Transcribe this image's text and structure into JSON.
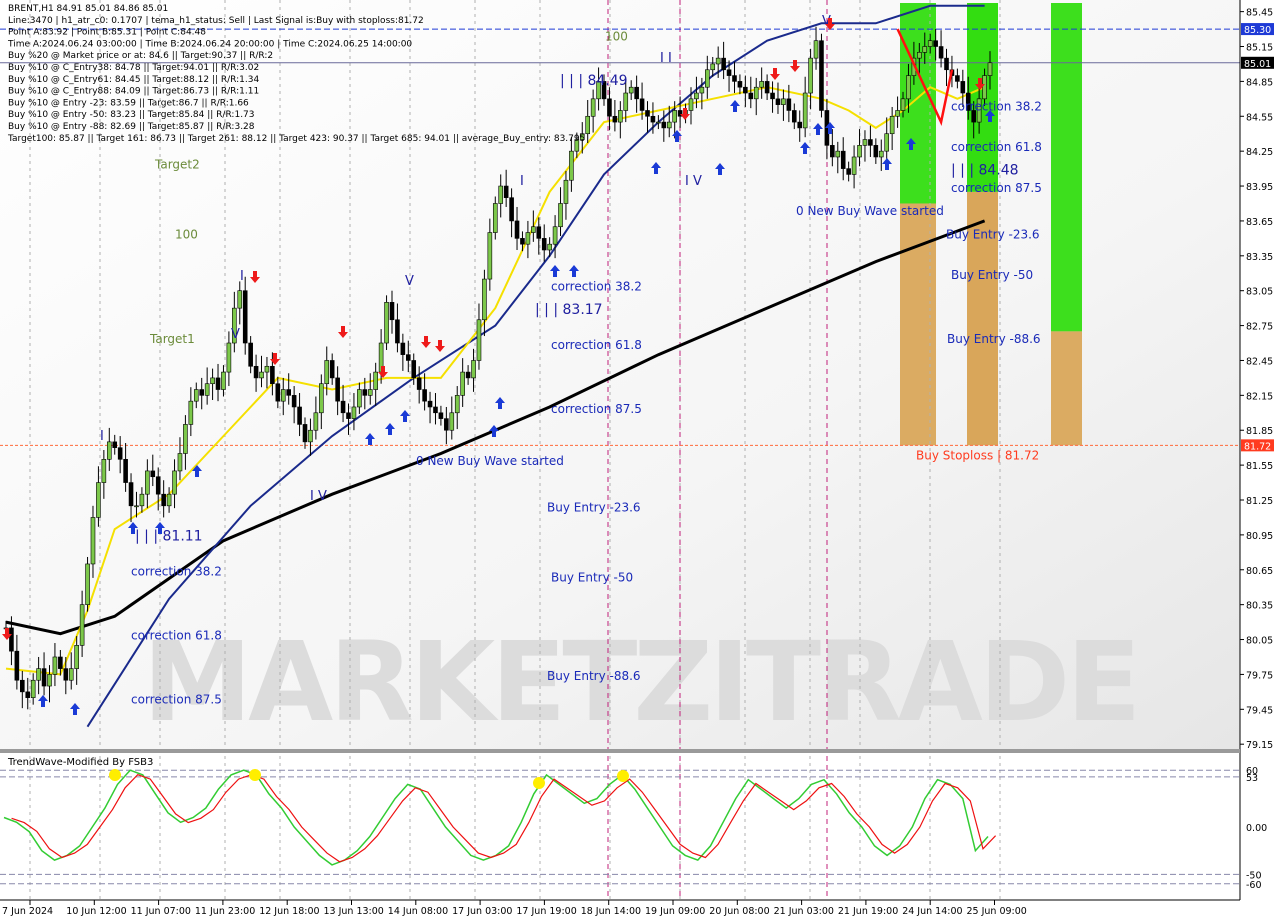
{
  "header": {
    "lines": [
      "BRENT,H1  84.91 85.01 84.86 85.01",
      "Line:3470  |  h1_atr_c0: 0.1707  |  tema_h1_status: Sell  |  Last Signal is:Buy with stoploss:81.72",
      "Point A:83.92  |  Point B:85.31  |  Point C:84.48",
      "Time A:2024.06.24 03:00:00  |  Time B:2024.06.24 20:00:00  |  Time C:2024.06.25 14:00:00",
      "Buy %20 @ Market price or at: 84.6  ||  Target:90.37  ||  R/R:2",
      "Buy %10 @ C_Entry38: 84.78  ||  Target:94.01  ||  R/R:3.02",
      "Buy %10 @ C_Entry61: 84.45  ||  Target:88.12  ||  R/R:1.34",
      "Buy %10 @ C_Entry88: 84.09  ||  Target:86.73  ||  R/R:1.11",
      "Buy %10 @ Entry -23: 83.59  ||  Target:86.7  ||  R/R:1.66",
      "Buy %10 @ Entry -50: 83.23  ||  Target:85.84  ||  R/R:1.73",
      "Buy %10 @ Entry -88: 82.69  ||  Target:85.87  ||  R/R:3.28",
      "Target100: 85.87  ||  Target 161: 86.73  ||  Target 261: 88.12  ||  Target 423: 90.37  ||  Target 685: 94.01  ||  average_Buy_entry: 83.795"
    ]
  },
  "watermark": "MARKETZITRADE",
  "chart_data": {
    "type": "line",
    "symbol": "BRENT,H1",
    "y_ticks": [
      "85.45",
      "85.15",
      "84.85",
      "84.55",
      "84.25",
      "83.95",
      "83.65",
      "83.35",
      "83.05",
      "82.75",
      "82.45",
      "82.15",
      "81.85",
      "81.55",
      "81.25",
      "80.95",
      "80.65",
      "80.35",
      "80.05",
      "79.75",
      "79.45",
      "79.15"
    ],
    "ylim": [
      79.1,
      85.55
    ],
    "x_ticks": [
      "7 Jun 2024",
      "10 Jun 12:00",
      "11 Jun 07:00",
      "11 Jun 23:00",
      "12 Jun 18:00",
      "13 Jun 13:00",
      "14 Jun 08:00",
      "17 Jun 03:00",
      "17 Jun 19:00",
      "18 Jun 14:00",
      "19 Jun 09:00",
      "20 Jun 08:00",
      "21 Jun 03:00",
      "21 Jun 19:00",
      "24 Jun 14:00",
      "25 Jun 09:00"
    ],
    "price_tags": [
      {
        "label": "85.30",
        "value": 85.3,
        "color": "#1e3ad6"
      },
      {
        "label": "85.01",
        "value": 85.01,
        "color": "#000000"
      },
      {
        "label": "81.72",
        "value": 81.72,
        "color": "#ff3b1f"
      }
    ],
    "close_series": [
      80.15,
      79.95,
      79.7,
      79.6,
      79.55,
      79.7,
      79.8,
      79.65,
      79.75,
      79.9,
      79.8,
      79.7,
      79.8,
      80.0,
      80.35,
      80.7,
      81.1,
      81.4,
      81.6,
      81.75,
      81.7,
      81.6,
      81.4,
      81.2,
      81.2,
      81.3,
      81.5,
      81.45,
      81.3,
      81.2,
      81.3,
      81.5,
      81.65,
      81.9,
      82.1,
      82.2,
      82.15,
      82.25,
      82.3,
      82.2,
      82.35,
      82.6,
      82.9,
      83.05,
      82.6,
      82.4,
      82.3,
      82.35,
      82.4,
      82.25,
      82.1,
      82.2,
      82.15,
      82.05,
      81.9,
      81.75,
      81.85,
      82.0,
      82.25,
      82.45,
      82.3,
      82.1,
      82.0,
      81.95,
      82.05,
      82.2,
      82.15,
      82.2,
      82.35,
      82.6,
      82.95,
      82.8,
      82.6,
      82.5,
      82.45,
      82.3,
      82.2,
      82.1,
      82.05,
      82.0,
      81.95,
      81.85,
      82.0,
      82.15,
      82.35,
      82.3,
      82.45,
      82.8,
      83.15,
      83.55,
      83.8,
      83.95,
      83.85,
      83.65,
      83.5,
      83.45,
      83.55,
      83.6,
      83.5,
      83.4,
      83.45,
      83.6,
      83.8,
      84.0,
      84.25,
      84.35,
      84.4,
      84.55,
      84.7,
      84.85,
      84.7,
      84.55,
      84.5,
      84.6,
      84.75,
      84.8,
      84.7,
      84.6,
      84.55,
      84.5,
      84.5,
      84.45,
      84.5,
      84.6,
      84.55,
      84.6,
      84.7,
      84.75,
      84.8,
      84.95,
      85.0,
      85.05,
      84.95,
      84.9,
      84.85,
      84.8,
      84.75,
      84.7,
      84.8,
      84.85,
      84.75,
      84.7,
      84.65,
      84.7,
      84.6,
      84.5,
      84.45,
      84.75,
      85.05,
      85.2,
      84.6,
      84.3,
      84.2,
      84.25,
      84.1,
      84.05,
      84.2,
      84.3,
      84.35,
      84.3,
      84.2,
      84.25,
      84.4,
      84.55,
      84.6,
      84.7,
      84.9,
      85.05,
      85.1,
      85.15,
      85.2,
      85.15,
      85.05,
      84.95,
      84.9,
      84.85,
      84.75,
      84.6,
      84.5,
      84.7,
      84.9,
      85.01
    ],
    "indicator_lines": [
      {
        "name": "long-ma",
        "color": "#000000",
        "points": [
          [
            0,
            80.2
          ],
          [
            10,
            80.1
          ],
          [
            20,
            80.25
          ],
          [
            40,
            80.9
          ],
          [
            60,
            81.3
          ],
          [
            80,
            81.65
          ],
          [
            100,
            82.05
          ],
          [
            120,
            82.5
          ],
          [
            140,
            82.9
          ],
          [
            160,
            83.3
          ],
          [
            180,
            83.65
          ]
        ]
      },
      {
        "name": "fast-ma",
        "color": "#1a2a8c",
        "points": [
          [
            15,
            79.3
          ],
          [
            30,
            80.4
          ],
          [
            45,
            81.2
          ],
          [
            60,
            81.8
          ],
          [
            75,
            82.3
          ],
          [
            90,
            82.75
          ],
          [
            100,
            83.35
          ],
          [
            110,
            84.05
          ],
          [
            120,
            84.5
          ],
          [
            130,
            84.9
          ],
          [
            140,
            85.2
          ],
          [
            150,
            85.35
          ],
          [
            160,
            85.35
          ],
          [
            170,
            85.5
          ],
          [
            180,
            85.5
          ]
        ]
      },
      {
        "name": "yellow-line",
        "color": "#f5e000",
        "points": [
          [
            0,
            79.8
          ],
          [
            10,
            79.75
          ],
          [
            15,
            80.3
          ],
          [
            20,
            81.0
          ],
          [
            30,
            81.3
          ],
          [
            40,
            81.8
          ],
          [
            50,
            82.3
          ],
          [
            60,
            82.2
          ],
          [
            70,
            82.3
          ],
          [
            80,
            82.3
          ],
          [
            90,
            82.9
          ],
          [
            100,
            83.9
          ],
          [
            110,
            84.5
          ],
          [
            120,
            84.6
          ],
          [
            130,
            84.7
          ],
          [
            140,
            84.8
          ],
          [
            150,
            84.7
          ],
          [
            155,
            84.6
          ],
          [
            160,
            84.45
          ],
          [
            165,
            84.6
          ],
          [
            170,
            84.8
          ],
          [
            175,
            84.7
          ],
          [
            180,
            84.8
          ]
        ]
      }
    ],
    "bands": [
      {
        "name": "green-band-1",
        "color": "#33dd11",
        "value_from": 83.8,
        "value_to": 85.55
      },
      {
        "name": "orange-band-1",
        "color": "#d9a65a",
        "value_from": 81.72,
        "value_to": 83.8
      },
      {
        "name": "green-band-2",
        "color": "#33dd11",
        "value_from": 82.7,
        "value_to": 85.55
      },
      {
        "name": "orange-band-2",
        "color": "#d9a65a",
        "value_from": 81.72,
        "value_to": 82.7
      }
    ],
    "annotations": [
      {
        "text": "100",
        "value": 85.2,
        "color": "#6b8b3a"
      },
      {
        "text": "| | | 84.49",
        "value": 84.82,
        "color": "#2020a0"
      },
      {
        "text": "Target2",
        "value": 84.1,
        "color": "#6b8b3a"
      },
      {
        "text": "100",
        "value": 83.5,
        "color": "#6b8b3a"
      },
      {
        "text": "Target1",
        "value": 82.6,
        "color": "#6b8b3a"
      },
      {
        "text": "correction 38.2",
        "value": 83.05,
        "color": "#1a2ab8"
      },
      {
        "text": "| | | 83.17",
        "value": 82.85,
        "color": "#2020a0"
      },
      {
        "text": "correction 61.8",
        "value": 82.55,
        "color": "#1a2ab8"
      },
      {
        "text": "correction 87.5",
        "value": 82.0,
        "color": "#1a2ab8"
      },
      {
        "text": "0 New Buy Wave started",
        "value": 81.55,
        "color": "#1a2ab8"
      },
      {
        "text": "Buy Entry -23.6",
        "value": 81.15,
        "color": "#1a2ab8"
      },
      {
        "text": "Buy Entry -50",
        "value": 80.55,
        "color": "#1a2ab8"
      },
      {
        "text": "Buy Entry -88.6",
        "value": 79.7,
        "color": "#1a2ab8"
      },
      {
        "text": "| | | 81.11",
        "value": 80.9,
        "color": "#2020a0"
      },
      {
        "text": "correction 38.2",
        "value": 80.6,
        "color": "#1a2ab8"
      },
      {
        "text": "correction 61.8",
        "value": 80.05,
        "color": "#1a2ab8"
      },
      {
        "text": "correction 87.5",
        "value": 79.5,
        "color": "#1a2ab8"
      },
      {
        "text": "correction 38.2",
        "value": 84.6,
        "color": "#1a2ab8"
      },
      {
        "text": "correction 61.8",
        "value": 84.25,
        "color": "#1a2ab8"
      },
      {
        "text": "| | | 84.48",
        "value": 84.05,
        "color": "#2020a0"
      },
      {
        "text": "correction 87.5",
        "value": 83.9,
        "color": "#1a2ab8"
      },
      {
        "text": "0 New Buy Wave started",
        "value": 83.7,
        "color": "#1a2ab8"
      },
      {
        "text": "Buy Entry -23.6",
        "value": 83.5,
        "color": "#1a2ab8"
      },
      {
        "text": "Buy Entry -50",
        "value": 83.15,
        "color": "#1a2ab8"
      },
      {
        "text": "Buy Entry -88.6",
        "value": 82.6,
        "color": "#1a2ab8"
      },
      {
        "text": "Buy Stoploss | 81.72",
        "value": 81.6,
        "color": "#ff3b1f"
      }
    ],
    "wave_labels": [
      "I",
      "I V",
      "V",
      "I",
      "I",
      "V",
      "I V",
      "I I",
      "V",
      "I V"
    ],
    "oscillator": {
      "title": "TrendWave-Modified By FSB3",
      "y_ticks": [
        "60",
        "53",
        "0.00",
        "-50",
        "-60"
      ],
      "ylim": [
        -75,
        75
      ],
      "levels": [
        60,
        53,
        -50,
        -60
      ],
      "green": [
        10,
        5,
        -5,
        -25,
        -35,
        -30,
        -20,
        0,
        20,
        45,
        60,
        55,
        35,
        15,
        5,
        10,
        20,
        40,
        55,
        60,
        55,
        35,
        20,
        0,
        -15,
        -30,
        -40,
        -35,
        -25,
        -10,
        10,
        30,
        45,
        40,
        20,
        0,
        -15,
        -30,
        -35,
        -30,
        -20,
        5,
        35,
        55,
        45,
        35,
        25,
        30,
        45,
        55,
        40,
        20,
        0,
        -20,
        -30,
        -35,
        -20,
        5,
        30,
        50,
        40,
        30,
        20,
        30,
        45,
        50,
        35,
        15,
        0,
        -20,
        -30,
        -20,
        0,
        30,
        50,
        45,
        30,
        -25,
        -10
      ]
    }
  }
}
